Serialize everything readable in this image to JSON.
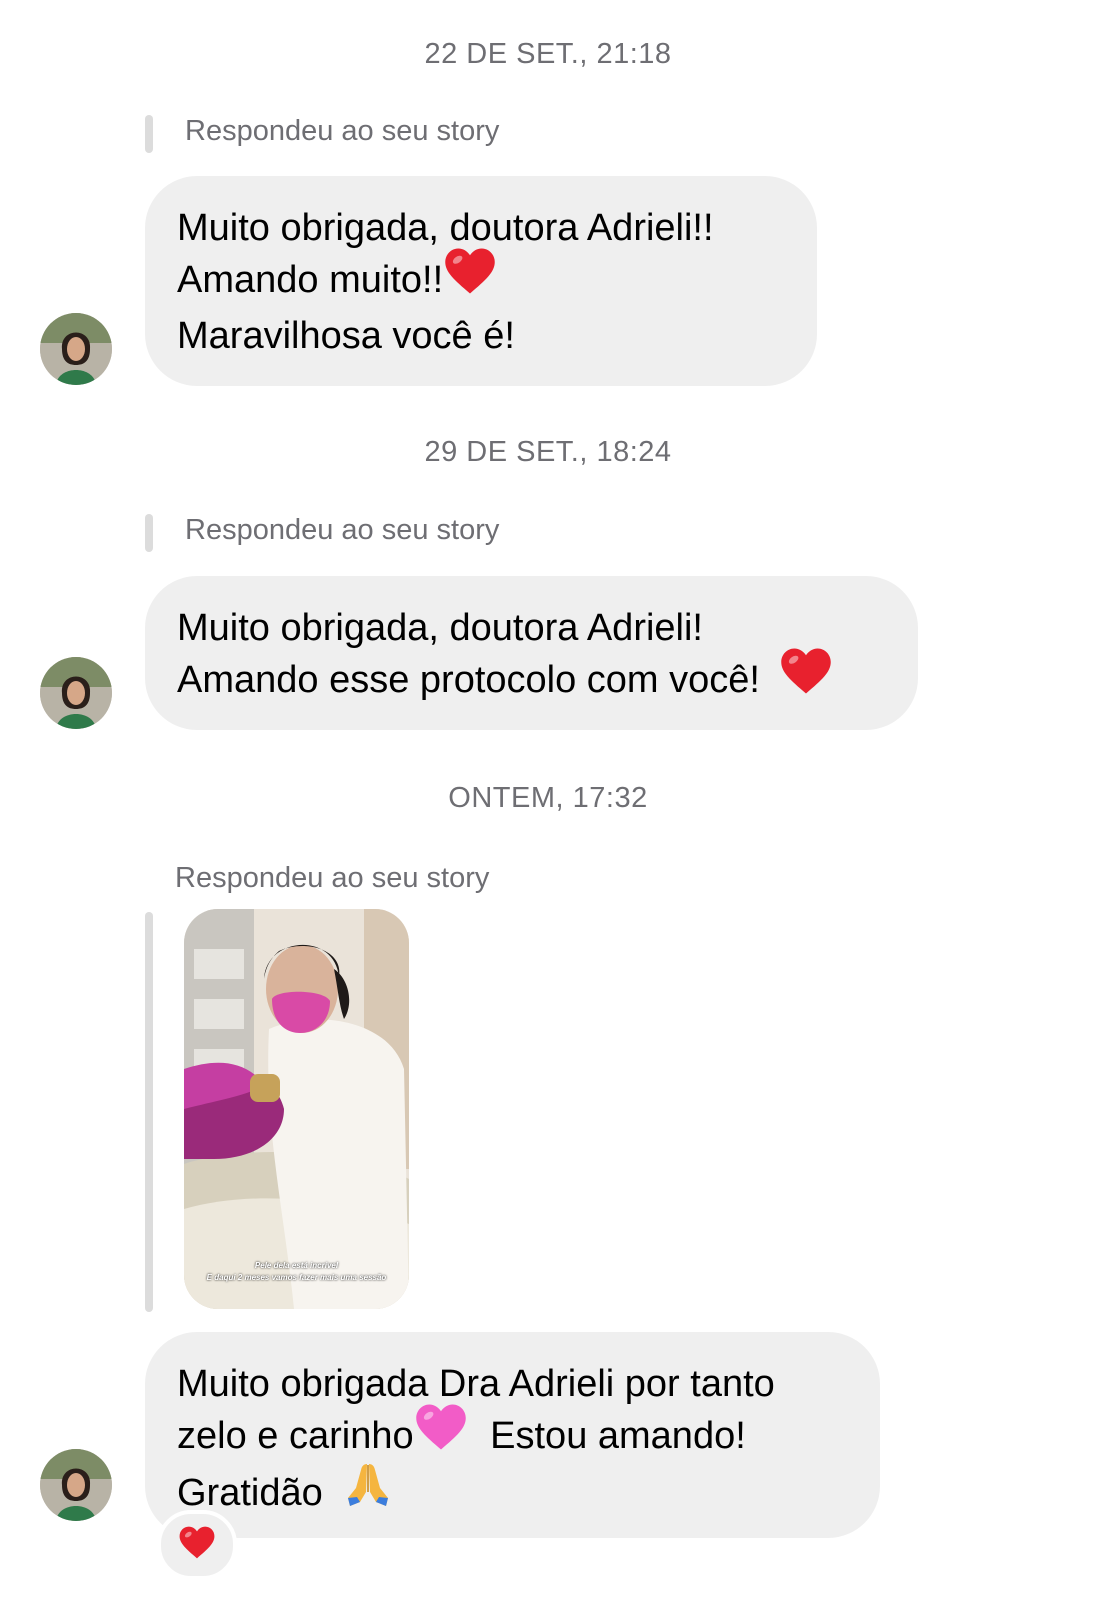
{
  "thread": {
    "timestamps": [
      "22 DE SET., 21:18",
      "29 DE SET., 18:24",
      "ONTEM, 17:32"
    ],
    "reply_label": "Respondeu ao seu story",
    "messages": [
      {
        "lines": [
          "Muito obrigada, doutora Adrieli!!",
          "Amando muito!!",
          "Maravilhosa você é!"
        ]
      },
      {
        "lines": [
          "Muito obrigada, doutora Adrieli!",
          "Amando esse protocolo com você!"
        ]
      },
      {
        "lines": [
          "Muito obrigada Dra Adrieli por tanto",
          "zelo e carinho",
          "Estou amando!",
          "Gratidão"
        ]
      }
    ],
    "story_caption": [
      "Pele dela está incrível",
      "E daqui 2 meses vamos fazer mais uma sessão"
    ],
    "emojis": [
      "red-heart",
      "red-heart",
      "pink-heart",
      "folded-hands"
    ],
    "reaction": "red-heart",
    "colors": {
      "bubble": "#efefef",
      "meta_text": "#6e6e73",
      "heart": "#e8212e",
      "pink_heart": "#f25cc7",
      "reply_bar": "#dcdcdc"
    }
  }
}
